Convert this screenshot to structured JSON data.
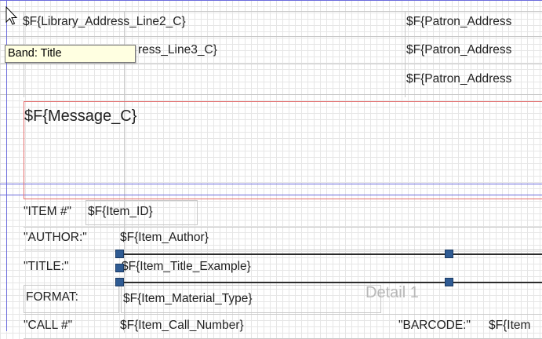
{
  "tooltip": {
    "text": "Band: Title"
  },
  "title_band": {
    "library_address_line2": "$F{Library_Address_Line2_C}",
    "library_address_line3": "$F{Library_Address_Line3_C}",
    "library_address_line3_visible": "ress_Line3_C}",
    "patron_address_1": "$F{Patron_Address",
    "patron_address_2": "$F{Patron_Address",
    "patron_address_3": "$F{Patron_Address",
    "message": "$F{Message_C}"
  },
  "detail_band": {
    "name": "Detail 1",
    "item_label": "\"ITEM #\"",
    "item_id": "$F{Item_ID}",
    "author_label": "\"AUTHOR:\"",
    "item_author": "$F{Item_Author}",
    "title_label": "\"TITLE:\"",
    "item_title": "$F{Item_Title_Example}",
    "format_label": "FORMAT:",
    "item_material_type": "$F{Item_Material_Type}",
    "call_label": "\"CALL #\"",
    "item_call_number": "$F{Item_Call_Number}",
    "barcode_label": "\"BARCODE:\"",
    "item_barcode": "$F{Item"
  },
  "colors": {
    "band_border": "#6b6bdc",
    "selected_frame": "#e36c6c",
    "handle": "#2f5b93",
    "tooltip_bg": "#ffffe1"
  },
  "icons": [
    "mouse-cursor-icon",
    "selection-handle-icon"
  ]
}
